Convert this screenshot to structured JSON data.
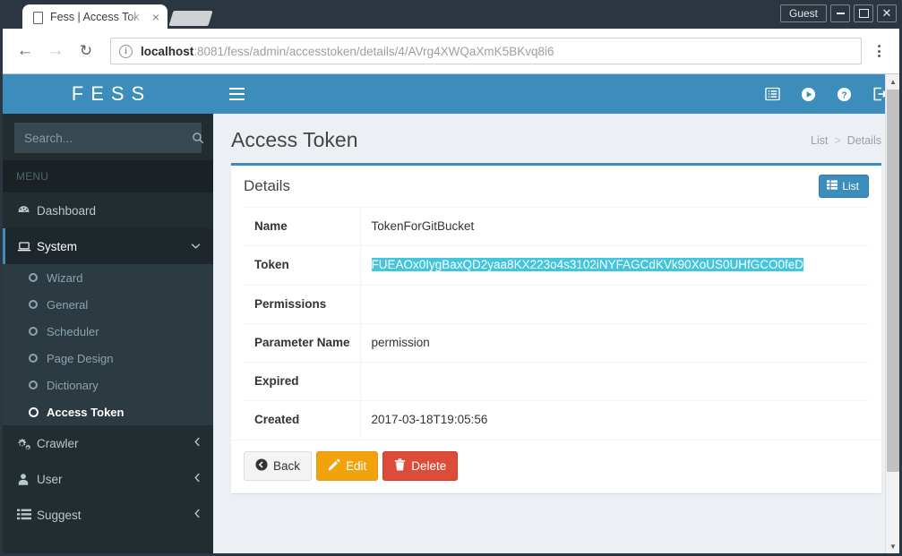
{
  "window": {
    "tab_title": "Fess | Access Tok",
    "tab_close_glyph": "×",
    "guest_label": "Guest",
    "close_glyph": "✕"
  },
  "browser": {
    "back_glyph": "←",
    "forward_glyph": "→",
    "reload_glyph": "↻",
    "info_glyph": "i",
    "url_host": "localhost",
    "url_rest": ":8081/fess/admin/accesstoken/details/4/AVrg4XWQaXmK5BKvq8i6"
  },
  "sidebar": {
    "brand": "FESS",
    "search_placeholder": "Search...",
    "search_value": "",
    "menu_header": "MENU",
    "items": [
      {
        "label": "Dashboard",
        "icon": "dashboard-icon",
        "arrow": ""
      },
      {
        "label": "System",
        "icon": "laptop-icon",
        "arrow": "⌄"
      },
      {
        "label": "Crawler",
        "icon": "gears-icon",
        "arrow": "‹"
      },
      {
        "label": "User",
        "icon": "user-icon",
        "arrow": "‹"
      },
      {
        "label": "Suggest",
        "icon": "list-icon",
        "arrow": "‹"
      }
    ],
    "system_submenu": [
      {
        "label": "Wizard"
      },
      {
        "label": "General"
      },
      {
        "label": "Scheduler"
      },
      {
        "label": "Page Design"
      },
      {
        "label": "Dictionary"
      },
      {
        "label": "Access Token"
      }
    ]
  },
  "topbar": {
    "icons": [
      {
        "name": "list-alt-icon"
      },
      {
        "name": "play-circle-icon"
      },
      {
        "name": "question-circle-icon"
      },
      {
        "name": "sign-out-icon"
      }
    ]
  },
  "main": {
    "page_title": "Access Token",
    "breadcrumb": {
      "link": "List",
      "separator": ">",
      "current": "Details"
    },
    "card_title": "Details",
    "list_button": "List",
    "rows": [
      {
        "label": "Name",
        "value": "TokenForGitBucket",
        "selected": false
      },
      {
        "label": "Token",
        "value": "FUEAOx0IygBaxQD2yaa8KX223o4s3102iNYFAGCdKVk90XoUS0UHfGCO0feD",
        "selected": true
      },
      {
        "label": "Permissions",
        "value": "",
        "selected": false
      },
      {
        "label": "Parameter Name",
        "value": "permission",
        "selected": false
      },
      {
        "label": "Expired",
        "value": "",
        "selected": false
      },
      {
        "label": "Created",
        "value": "2017-03-18T19:05:56",
        "selected": false
      }
    ],
    "buttons": {
      "back": "Back",
      "edit": "Edit",
      "delete": "Delete"
    }
  },
  "colors": {
    "brand_blue": "#3c8dbc",
    "sidebar_dark": "#222d32",
    "selection_cyan": "#43c6db",
    "edit_orange": "#f0a30a",
    "delete_red": "#dd4b39"
  }
}
